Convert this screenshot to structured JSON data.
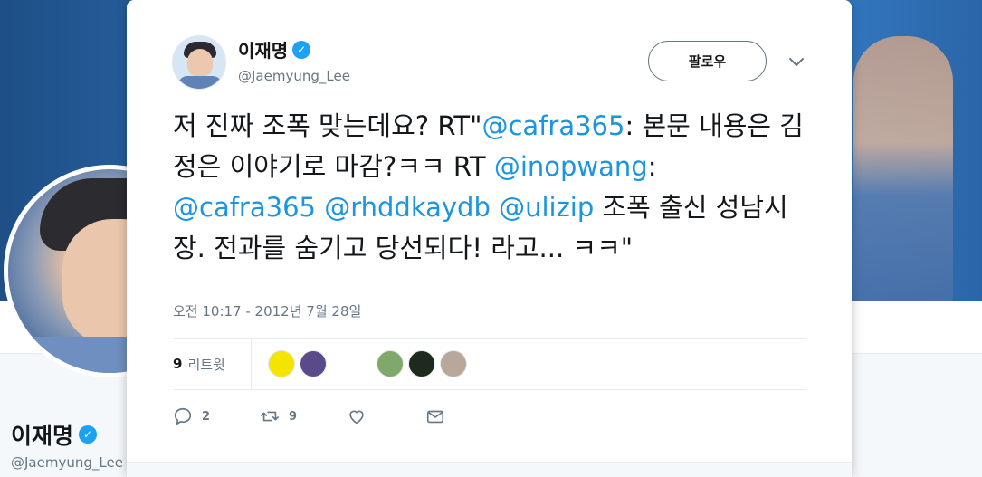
{
  "background_profile": {
    "name": "이재명",
    "handle": "@Jaemyung_Lee"
  },
  "tweet": {
    "author": {
      "name": "이재명",
      "handle": "@Jaemyung_Lee",
      "verified": true
    },
    "follow_label": "팔로우",
    "text_parts": [
      {
        "type": "text",
        "value": "저 진짜 조폭 맞는데요? RT\""
      },
      {
        "type": "mention",
        "value": "@cafra365"
      },
      {
        "type": "text",
        "value": ": 본문 내용은 김정은 이야기로 마감?ㅋㅋ RT "
      },
      {
        "type": "mention",
        "value": "@inopwang"
      },
      {
        "type": "text",
        "value": ": "
      },
      {
        "type": "mention",
        "value": "@cafra365"
      },
      {
        "type": "text",
        "value": " "
      },
      {
        "type": "mention",
        "value": "@rhddkaydb"
      },
      {
        "type": "text",
        "value": " "
      },
      {
        "type": "mention",
        "value": "@ulizip"
      },
      {
        "type": "text",
        "value": " 조폭 출신 성남시장. 전과를 숨기고 당선되다! 라고... ㅋㅋ\""
      }
    ],
    "timestamp": "오전 10:17 - 2012년 7월 28일",
    "retweet_count": "9",
    "retweet_label": "리트윗",
    "retweeters": [
      "#f5e400",
      "#5a4a8a",
      "#7fa86a",
      "#1d2a1d",
      "#b8a89a"
    ],
    "actions": {
      "reply_count": "2",
      "retweet_count": "9",
      "like_count": "",
      "message_count": ""
    }
  },
  "colors": {
    "accent": "#1da1f2",
    "mention": "#1b95e0",
    "secondary_text": "#657786"
  }
}
